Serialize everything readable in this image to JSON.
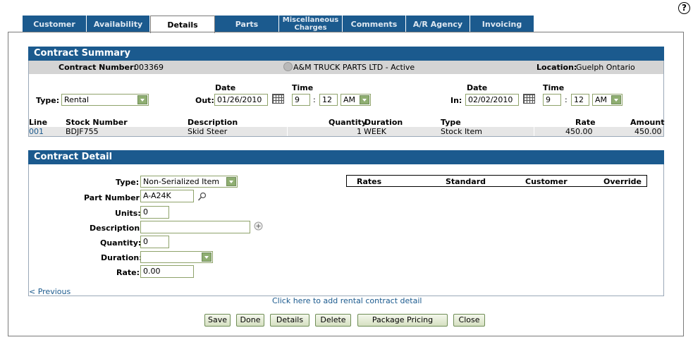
{
  "help_icon": "?",
  "tabs": [
    {
      "label": "Customer",
      "active": false
    },
    {
      "label": "Availability",
      "active": false
    },
    {
      "label": "Details",
      "active": true
    },
    {
      "label": "Parts",
      "active": false
    },
    {
      "label": "Miscellaneous Charges",
      "active": false
    },
    {
      "label": "Comments",
      "active": false
    },
    {
      "label": "A/R Agency",
      "active": false
    },
    {
      "label": "Invoicing",
      "active": false
    }
  ],
  "summary": {
    "title": "Contract Summary",
    "contract_number_label": "Contract Number:",
    "contract_number": "003369",
    "customer": "A&M TRUCK PARTS LTD - Active",
    "location_label": "Location:",
    "location": "Guelph Ontario",
    "type_label": "Type:",
    "type_value": "Rental",
    "out_label": "Out:",
    "in_label": "In:",
    "date_header": "Date",
    "time_header": "Time",
    "out_date": "01/26/2010",
    "out_hour": "9",
    "out_min": "12",
    "out_ampm": "AM",
    "in_date": "02/02/2010",
    "in_hour": "9",
    "in_min": "12",
    "in_ampm": "AM",
    "time_sep": ":",
    "columns": {
      "line": "Line",
      "stock": "Stock Number",
      "desc": "Description",
      "qty": "Quantity",
      "duration": "Duration",
      "type": "Type",
      "rate": "Rate",
      "amount": "Amount"
    },
    "row": {
      "line": "001",
      "stock": "BDJF755",
      "desc": "Skid Steer",
      "qty": "1",
      "duration": "WEEK",
      "type": "Stock Item",
      "rate": "450.00",
      "amount": "450.00"
    }
  },
  "detail": {
    "title": "Contract Detail",
    "type_label": "Type:",
    "type_value": "Non-Serialized Item",
    "part_label": "Part Number:",
    "part_value": "A-A24K",
    "units_label": "Units:",
    "units_value": "0",
    "description_label": "Description:",
    "description_value": "",
    "quantity_label": "Quantity:",
    "quantity_value": "0",
    "duration_label": "Duration:",
    "duration_value": "",
    "rate_label": "Rate:",
    "rate_value": "0.00",
    "rates_table": {
      "rates": "Rates",
      "standard": "Standard",
      "customer": "Customer",
      "override": "Override"
    },
    "previous_link": "< Previous",
    "add_link": "Click here to add rental contract detail"
  },
  "buttons": {
    "save": "Save",
    "done": "Done",
    "details": "Details",
    "delete": "Delete",
    "package": "Package Pricing",
    "close": "Close"
  }
}
